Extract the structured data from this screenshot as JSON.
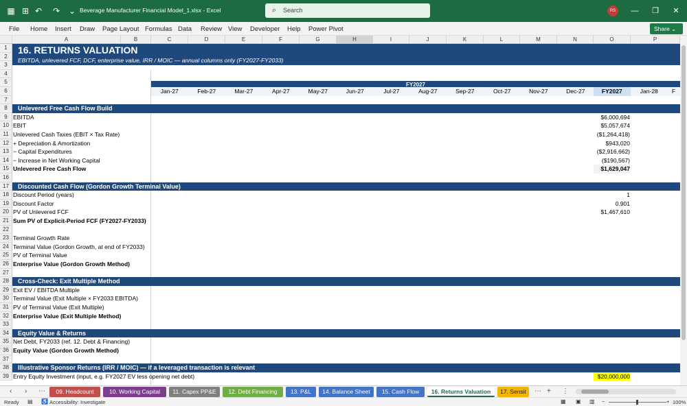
{
  "window": {
    "doc_title": "Beverage Manufacturer Financial Model_1.xlsx  -  Excel",
    "search_placeholder": "Search",
    "user_initials": "RS"
  },
  "menu": [
    "File",
    "Home",
    "Insert",
    "Draw",
    "Page Layout",
    "Formulas",
    "Data",
    "Review",
    "View",
    "Developer",
    "Help",
    "Power Pivot"
  ],
  "share_label": "Share",
  "columns": [
    "A",
    "B",
    "C",
    "D",
    "E",
    "F",
    "G",
    "H",
    "I",
    "J",
    "K",
    "L",
    "M",
    "N",
    "O",
    "P"
  ],
  "sheet": {
    "title": "16.  RETURNS VALUATION",
    "subtitle": "EBITDA, unlevered FCF, DCF, enterprise value, IRR / MOIC — annual columns only (FY2027-FY2033)",
    "fy_label": "FY2027",
    "months": [
      "Jan-27",
      "Feb-27",
      "Mar-27",
      "Apr-27",
      "May-27",
      "Jun-27",
      "Jul-27",
      "Aug-27",
      "Sep-27",
      "Oct-27",
      "Nov-27",
      "Dec-27",
      "FY2027",
      "Jan-28",
      "F"
    ],
    "rows": [
      {
        "n": "1"
      },
      {
        "n": "2"
      },
      {
        "n": "3"
      },
      {
        "n": "4"
      },
      {
        "n": "5"
      },
      {
        "n": "6"
      },
      {
        "n": "7"
      },
      {
        "n": "8",
        "band": "Unlevered Free Cash Flow Build"
      },
      {
        "n": "9",
        "label": "EBITDA",
        "fy": "$6,000,694"
      },
      {
        "n": "10",
        "label": "EBIT",
        "fy": "$5,057,674"
      },
      {
        "n": "11",
        "label": "Unlevered Cash Taxes (EBIT × Tax Rate)",
        "fy": "($1,264,418)"
      },
      {
        "n": "12",
        "label": "+ Depreciation & Amortization",
        "fy": "$943,020"
      },
      {
        "n": "13",
        "label": "− Capital Expenditures",
        "fy": "($2,916,662)"
      },
      {
        "n": "14",
        "label": "− Increase in Net Working Capital",
        "fy": "($190,567)"
      },
      {
        "n": "15",
        "label": "Unlevered Free Cash Flow",
        "fy": "$1,629,047",
        "bold": true
      },
      {
        "n": "16"
      },
      {
        "n": "17",
        "band": "Discounted Cash Flow (Gordon Growth Terminal Value)"
      },
      {
        "n": "18",
        "label": "Discount Period (years)",
        "fy": "1"
      },
      {
        "n": "19",
        "label": "Discount Factor",
        "fy": "0.901"
      },
      {
        "n": "20",
        "label": "PV of Unlevered FCF",
        "fy": "$1,467,610"
      },
      {
        "n": "21",
        "label": "Sum PV of Explicit-Period FCF (FY2027-FY2033)",
        "bold": true
      },
      {
        "n": "22"
      },
      {
        "n": "23",
        "label": "Terminal Growth Rate"
      },
      {
        "n": "24",
        "label": "Terminal Value (Gordon Growth, at end of FY2033)"
      },
      {
        "n": "25",
        "label": "PV of Terminal Value"
      },
      {
        "n": "26",
        "label": "Enterprise Value (Gordon Growth Method)",
        "bold": true
      },
      {
        "n": "27"
      },
      {
        "n": "28",
        "band": "Cross-Check: Exit Multiple Method"
      },
      {
        "n": "29",
        "label": "Exit EV / EBITDA Multiple"
      },
      {
        "n": "30",
        "label": "Terminal Value (Exit Multiple × FY2033 EBITDA)"
      },
      {
        "n": "31",
        "label": "PV of Terminal Value (Exit Multiple)"
      },
      {
        "n": "32",
        "label": "Enterprise Value (Exit Multiple Method)",
        "bold": true
      },
      {
        "n": "33"
      },
      {
        "n": "34",
        "band": "Equity Value & Returns"
      },
      {
        "n": "35",
        "label": "Net Debt, FY2033 (ref. 12. Debt & Financing)"
      },
      {
        "n": "36",
        "label": "Equity Value (Gordon Growth Method)",
        "bold": true
      },
      {
        "n": "37"
      },
      {
        "n": "38",
        "band": "Illustrative Sponsor Returns (IRR / MOIC) — if a leveraged transaction is relevant"
      },
      {
        "n": "39",
        "label": "Entry Equity Investment (input, e.g. FY2027 EV less opening net debt)",
        "fy": "$20,000,000",
        "input": true
      }
    ]
  },
  "tabs": [
    {
      "label": "09. Headcount",
      "color": "#c0504d"
    },
    {
      "label": "10. Working Capital",
      "color": "#7b3f8c"
    },
    {
      "label": "11. Capex PP&E",
      "color": "#7f7f7f"
    },
    {
      "label": "12. Debt Financing",
      "color": "#70ad47"
    },
    {
      "label": "13. P&L",
      "color": "#4472c4"
    },
    {
      "label": "14. Balance Sheet",
      "color": "#4472c4"
    },
    {
      "label": "15. Cash Flow",
      "color": "#4472c4"
    },
    {
      "label": "16. Returns Valuation",
      "color": "#ffffff",
      "active": true
    },
    {
      "label": "17. Sensit",
      "color": "#f2b600"
    }
  ],
  "status": {
    "ready": "Ready",
    "accessibility": "Accessibility: Investigate",
    "zoom": "100%"
  }
}
